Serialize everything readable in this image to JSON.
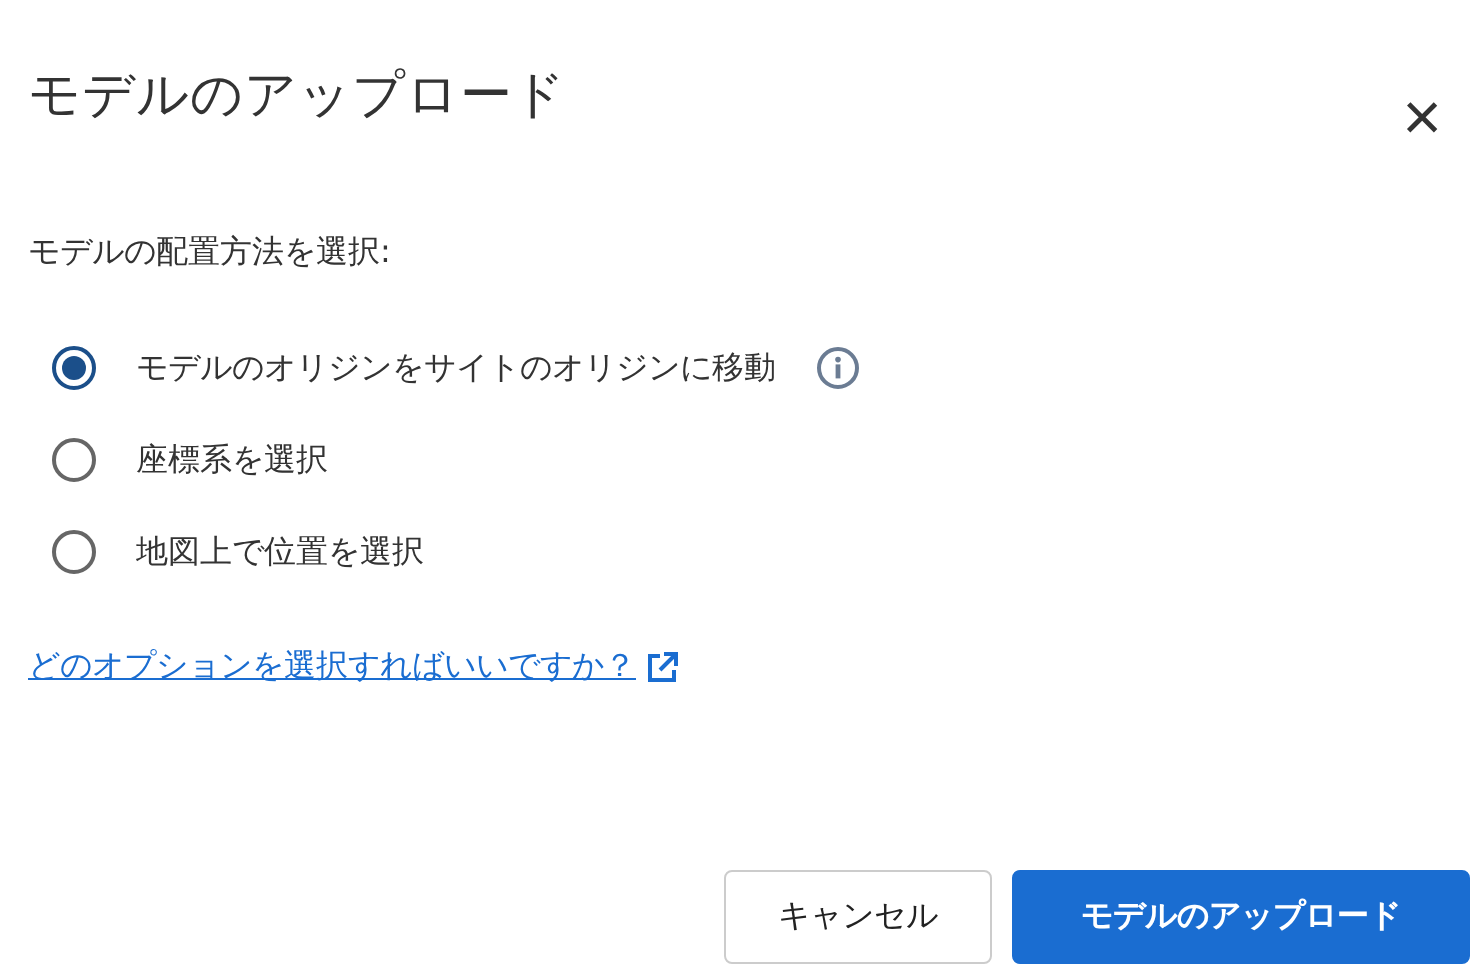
{
  "dialog": {
    "title": "モデルのアップロード",
    "close": "×"
  },
  "prompt": "モデルの配置方法を選択:",
  "options": [
    {
      "label": "モデルのオリジンをサイトのオリジンに移動",
      "selected": true,
      "info": true
    },
    {
      "label": "座標系を選択",
      "selected": false,
      "info": false
    },
    {
      "label": "地図上で位置を選択",
      "selected": false,
      "info": false
    }
  ],
  "help_link": "どのオプションを選択すればいいですか？",
  "buttons": [
    {
      "label": "キャンセル",
      "kind": "secondary"
    },
    {
      "label": "モデルのアップロード",
      "kind": "primary"
    }
  ]
}
